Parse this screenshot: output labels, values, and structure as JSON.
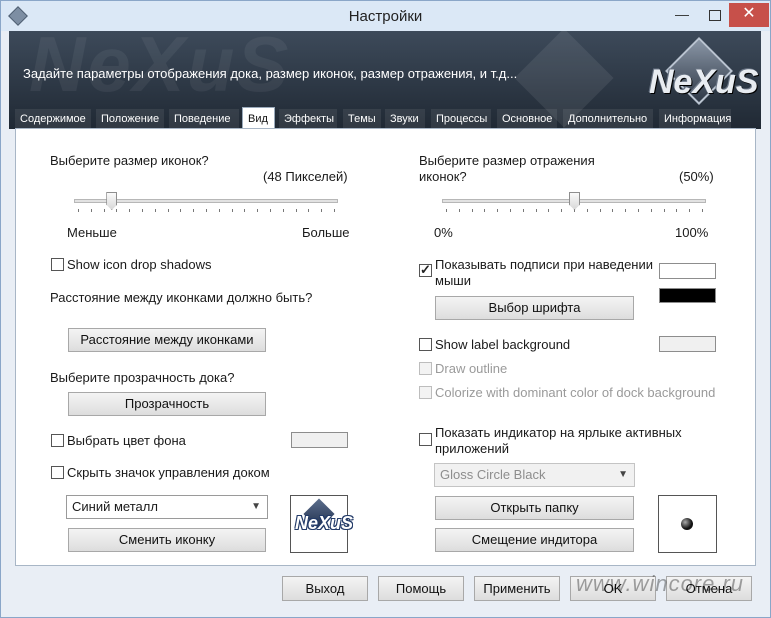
{
  "window": {
    "title": "Настройки"
  },
  "banner": {
    "description": "Задайте параметры отображения дока, размер иконок, размер отражения, и т.д...",
    "logo_text": "NeXuS"
  },
  "tabs": [
    {
      "label": "Содержимое"
    },
    {
      "label": "Положение"
    },
    {
      "label": "Поведение"
    },
    {
      "label": "Вид",
      "active": true
    },
    {
      "label": "Эффекты"
    },
    {
      "label": "Темы"
    },
    {
      "label": "Звуки"
    },
    {
      "label": "Процессы"
    },
    {
      "label": "Основное"
    },
    {
      "label": "Дополнительно"
    },
    {
      "label": "Информация"
    }
  ],
  "left": {
    "icon_size": {
      "label": "Выберите размер иконок?",
      "value_text": "(48 Пикселей)",
      "min_label": "Меньше",
      "max_label": "Больше",
      "position": 0.13
    },
    "drop_shadows": {
      "label": "Show icon drop shadows",
      "checked": false
    },
    "spacing": {
      "label": "Расстояние между иконками должно быть?",
      "button": "Расстояние между иконками"
    },
    "transparency": {
      "label": "Выберите прозрачность дока?",
      "button": "Прозрачность"
    },
    "bg_color": {
      "label": "Выбрать цвет фона",
      "checked": false
    },
    "hide_icon": {
      "label": "Скрыть значок управления доком",
      "checked": false
    },
    "icon_select": {
      "value": "Синий металл"
    },
    "change_icon_button": "Сменить иконку",
    "preview_logo_text": "NeXuS"
  },
  "right": {
    "reflection": {
      "label_line1": "Выберите размер отражения",
      "label_line2": "иконок?",
      "value_text": "(50%)",
      "min_label": "0%",
      "max_label": "100%",
      "position": 0.5
    },
    "labels_hover": {
      "label_line1": "Показывать подписи при наведении",
      "label_line2": "мыши",
      "checked": true
    },
    "font_button": "Выбор шрифта",
    "label_bg": {
      "label": "Show label background",
      "checked": false
    },
    "draw_outline": {
      "label": "Draw outline",
      "checked": false,
      "disabled": true
    },
    "colorize": {
      "label": "Colorize with dominant color of dock background",
      "checked": false,
      "disabled": true
    },
    "indicator": {
      "label_line1": "Показать индикатор на ярлыке активных",
      "label_line2": "приложений",
      "checked": false
    },
    "indicator_select": {
      "value": "Gloss Circle Black"
    },
    "open_folder_button": "Открыть папку",
    "offset_button": "Смещение индитора"
  },
  "colors": {
    "font_swatch": "#000000",
    "hover_swatch": "#ffffff",
    "label_bg_swatch": "#f0f0f0",
    "bg_swatch": "#f0f0f0"
  },
  "footer": {
    "exit": "Выход",
    "help": "Помощь",
    "apply": "Применить",
    "ok": "OK",
    "cancel": "Отмена"
  },
  "watermark": "www.wincore.ru"
}
